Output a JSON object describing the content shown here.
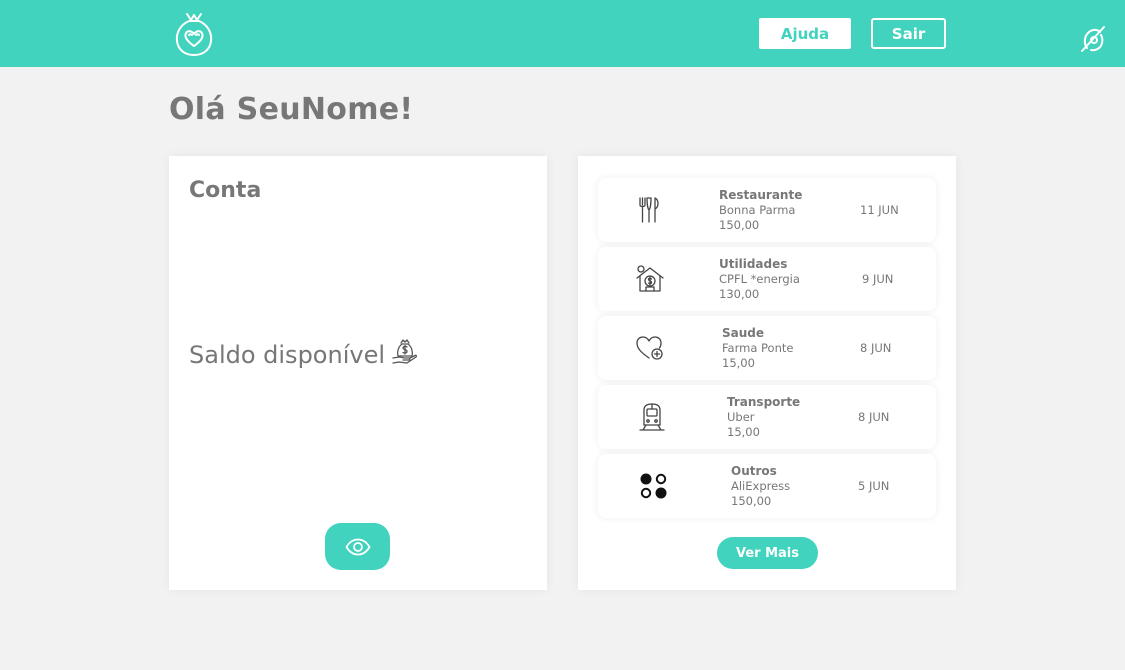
{
  "header": {
    "logo_icon": "pouch-heart-logo-icon",
    "help_label": "Ajuda",
    "logout_label": "Sair",
    "privacy_icon": "eye-slash-icon",
    "brand_color": "#41d3bd"
  },
  "greeting": "Olá SeuNome!",
  "account": {
    "title": "Conta",
    "balance_label": "Saldo disponível",
    "balance_icon": "money-bag-icon",
    "toggle_icon": "eye-icon"
  },
  "transactions": [
    {
      "icon": "cutlery-icon",
      "category": "Restaurante",
      "merchant": "Bonna Parma",
      "amount": "150,00",
      "date": "11 JUN"
    },
    {
      "icon": "house-money-icon",
      "category": "Utilidades",
      "merchant": "CPFL *energia",
      "amount": "130,00",
      "date": "9 JUN"
    },
    {
      "icon": "heart-plus-icon",
      "category": "Saude",
      "merchant": "Farma Ponte",
      "amount": "15,00",
      "date": "8 JUN"
    },
    {
      "icon": "train-icon",
      "category": "Transporte",
      "merchant": "Uber",
      "amount": "15,00",
      "date": "8 JUN"
    },
    {
      "icon": "four-circles-icon",
      "category": "Outros",
      "merchant": "AliExpress",
      "amount": "150,00",
      "date": "5 JUN"
    }
  ],
  "see_more_label": "Ver Mais"
}
